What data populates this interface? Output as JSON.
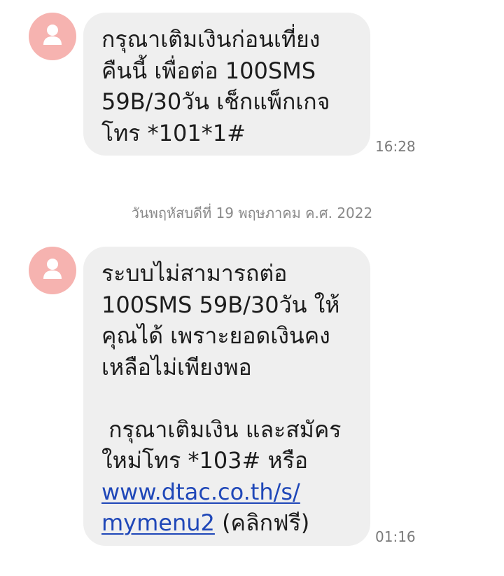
{
  "messages": [
    {
      "lines": [
        "กรุณาเติมเงินก่อนเที่ยง",
        "คืนนี้ เพื่อต่อ 100SMS",
        "59B/30วัน เช็กแพ็กเกจ",
        "โทร *101*1#"
      ],
      "time": "16:28"
    },
    {
      "lines": [
        "ระบบไม่สามารถต่อ",
        "100SMS 59B/30วัน ให้",
        "คุณได้ เพราะยอดเงินคง",
        "เหลือไม่เพียงพอ",
        " กรุณาเติมเงิน และสมัคร",
        "ใหม่โทร *103# หรือ"
      ],
      "link_line1": "www.dtac.co.th/s/",
      "link_line2": "mymenu2",
      "link_suffix": " (คลิกฟรี)",
      "time": "01:16"
    }
  ],
  "date_separator": "วันพฤหัสบดีที่ 19 พฤษภาคม ค.ศ. 2022",
  "colors": {
    "avatar_bg": "#f6b3b0",
    "bubble_bg": "#efefef",
    "link": "#1f47b8",
    "time_text": "#7a7a7a"
  },
  "icons": {
    "avatar": "person-icon"
  }
}
